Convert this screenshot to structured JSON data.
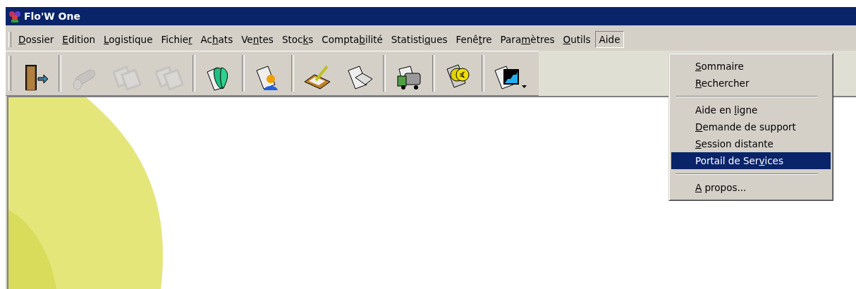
{
  "window": {
    "title": "Flo'W One"
  },
  "menu_bar": [
    {
      "key": "D",
      "suffix": "ossier",
      "selected": false
    },
    {
      "key": "E",
      "suffix": "dition",
      "selected": false
    },
    {
      "key": "L",
      "suffix": "ogistique",
      "selected": false
    },
    {
      "prefix": "Fichie",
      "key": "r",
      "selected": false
    },
    {
      "prefix": "Ac",
      "key": "h",
      "suffix": "ats",
      "selected": false
    },
    {
      "prefix": "Ve",
      "key": "n",
      "suffix": "tes",
      "selected": false
    },
    {
      "prefix": "Stoc",
      "key": "k",
      "suffix": "s",
      "selected": false
    },
    {
      "prefix": "Compta",
      "key": "b",
      "suffix": "ilité",
      "selected": false
    },
    {
      "prefix": "Statisti",
      "key": "q",
      "suffix": "ues",
      "selected": false
    },
    {
      "prefix": "Fenê",
      "key": "t",
      "suffix": "re",
      "selected": false
    },
    {
      "prefix": "Para",
      "key": "m",
      "suffix": "ètres",
      "selected": false
    },
    {
      "key": "O",
      "suffix": "utils",
      "selected": false
    },
    {
      "prefix": "Aide",
      "selected": true
    }
  ],
  "toolbar": {
    "groups": [
      {
        "buttons": [
          {
            "kind": "door",
            "disabled": false
          }
        ]
      },
      {
        "buttons": [
          {
            "kind": "log",
            "disabled": true
          },
          {
            "kind": "frames",
            "disabled": true
          },
          {
            "kind": "frames",
            "disabled": true
          }
        ]
      },
      {
        "buttons": [
          {
            "kind": "leaf",
            "disabled": false
          }
        ]
      },
      {
        "buttons": [
          {
            "kind": "person",
            "disabled": false
          }
        ]
      },
      {
        "buttons": [
          {
            "kind": "clipboard",
            "disabled": false
          },
          {
            "kind": "book",
            "disabled": false
          }
        ]
      },
      {
        "buttons": [
          {
            "kind": "truck",
            "disabled": false
          }
        ]
      },
      {
        "buttons": [
          {
            "kind": "coins",
            "disabled": false
          }
        ]
      },
      {
        "buttons": [
          {
            "kind": "chart",
            "disabled": false,
            "dropdown": true
          }
        ]
      }
    ]
  },
  "dropdown_menu": [
    {
      "kind": "item",
      "key": "S",
      "suffix": "ommaire",
      "selected": false
    },
    {
      "kind": "item",
      "key": "R",
      "suffix": "echercher",
      "selected": false
    },
    {
      "kind": "separator"
    },
    {
      "kind": "item",
      "prefix": "Aide en ",
      "key": "l",
      "suffix": "igne",
      "selected": false
    },
    {
      "kind": "item",
      "key": "D",
      "suffix": "emande de support",
      "selected": false
    },
    {
      "kind": "item",
      "key": "S",
      "suffix": "ession distante",
      "selected": false
    },
    {
      "kind": "item",
      "prefix": "Portail de Ser",
      "key": "v",
      "suffix": "ices",
      "selected": true
    },
    {
      "kind": "separator"
    },
    {
      "kind": "item",
      "key": "A",
      "suffix": " propos...",
      "selected": false
    }
  ]
}
